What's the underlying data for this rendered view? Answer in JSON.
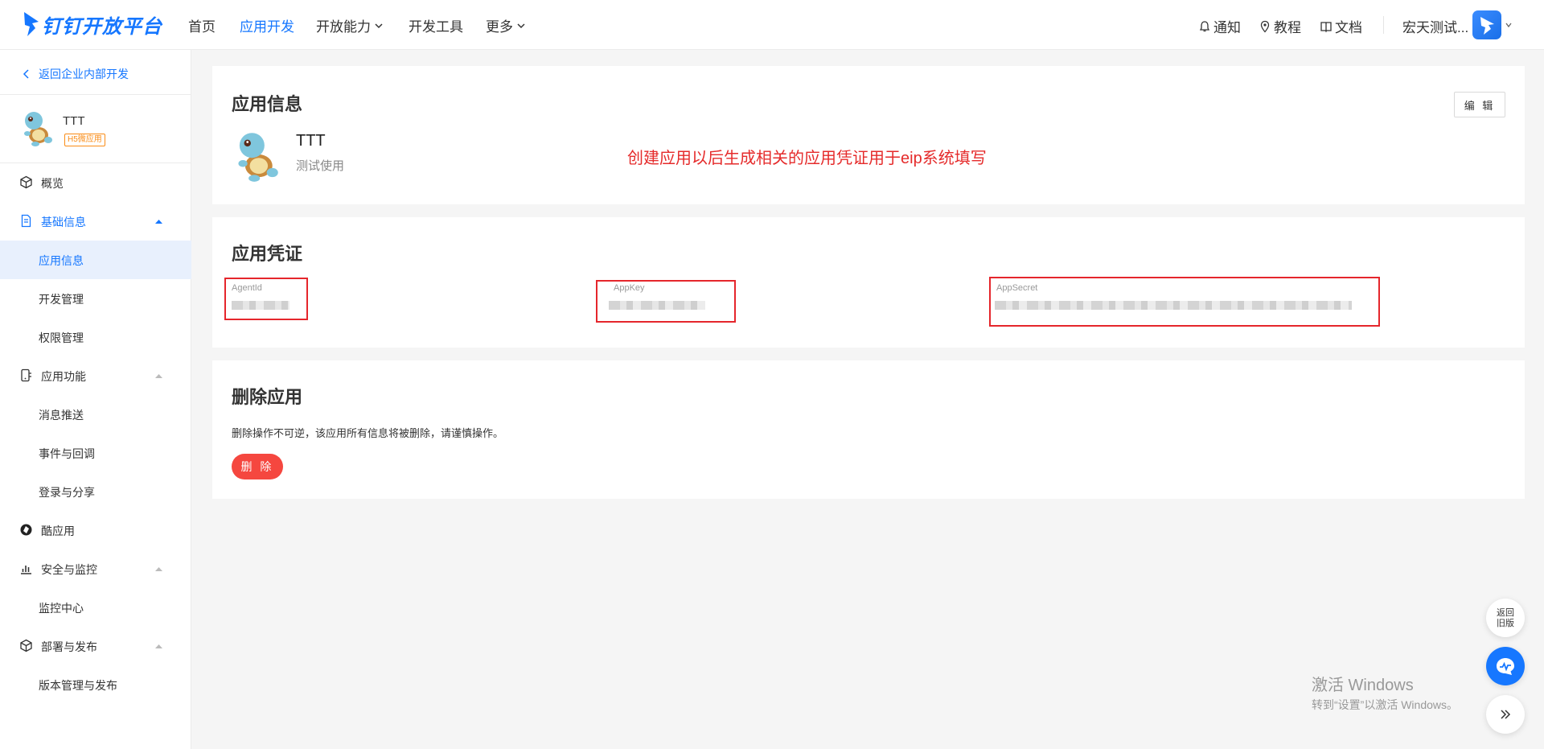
{
  "topnav": {
    "brand": "钉钉开放平台",
    "items": [
      {
        "label": "首页",
        "active": false
      },
      {
        "label": "应用开发",
        "active": true
      },
      {
        "label": "开放能力",
        "active": false
      },
      {
        "label": "开发工具",
        "active": false
      },
      {
        "label": "更多",
        "active": false
      }
    ],
    "right": {
      "notify": "通知",
      "tutorial": "教程",
      "docs": "文档",
      "org": "宏天测试..."
    },
    "colors": {
      "brand": "#1677ff"
    }
  },
  "sidebar": {
    "back": "返回企业内部开发",
    "app": {
      "name": "TTT",
      "tag": "H5微应用"
    },
    "groups": [
      {
        "label": "概览"
      },
      {
        "label": "基础信息",
        "sub": [
          "应用信息",
          "开发管理",
          "权限管理"
        ]
      },
      {
        "label": "应用功能",
        "sub": [
          "消息推送",
          "事件与回调",
          "登录与分享"
        ]
      },
      {
        "label": "酷应用"
      },
      {
        "label": "安全与监控",
        "sub": [
          "监控中心"
        ]
      },
      {
        "label": "部署与发布",
        "sub": [
          "版本管理与发布"
        ]
      }
    ],
    "selected": "应用信息"
  },
  "app_info": {
    "title": "应用信息",
    "edit": "编 辑",
    "name": "TTT",
    "desc": "测试使用",
    "note": "创建应用以后生成相关的应用凭证用于eip系统填写",
    "note_color": "#e52b2b"
  },
  "credentials": {
    "title": "应用凭证",
    "fields": [
      {
        "label": "AgentId"
      },
      {
        "label": "AppKey"
      },
      {
        "label": "AppSecret"
      }
    ]
  },
  "delete": {
    "title": "删除应用",
    "text": "删除操作不可逆，该应用所有信息将被删除，请谨慎操作。",
    "button": "删 除",
    "button_color": "#f5473f"
  },
  "float": {
    "old_line1": "返回",
    "old_line2": "旧版"
  },
  "watermark": {
    "line1": "激活 Windows",
    "line2": "转到“设置”以激活 Windows。"
  }
}
